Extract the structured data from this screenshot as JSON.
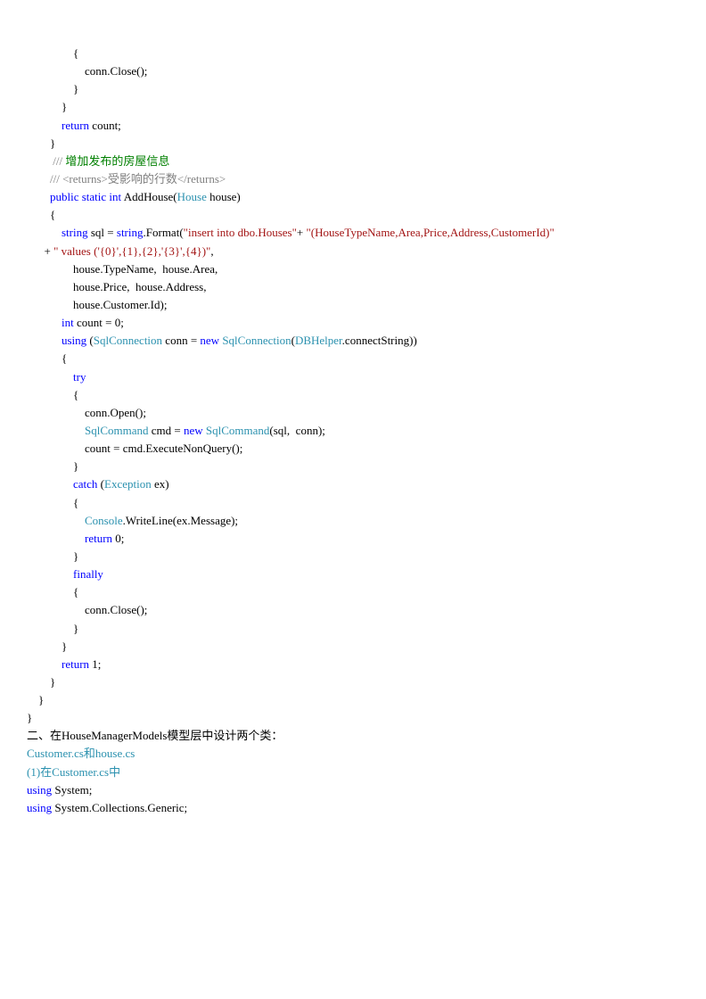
{
  "code": {
    "l1": "                {",
    "l2a": "                    conn.",
    "l2b": "Close();",
    "l3": "                }",
    "l4": "            }",
    "l5a": "            return",
    "l5b": " count;",
    "l6": "        }",
    "l7a": "         /// ",
    "l7b": "增加发布的房屋信息",
    "l8": "        /// <returns>受影响的行数</returns>",
    "l9a": "        public static int ",
    "l9b": "AddHouse(",
    "l9c": "House ",
    "l9d": "house)",
    "l10": "        {",
    "l11a": "            string ",
    "l11b": "sql = ",
    "l11c": "string",
    "l11d": ".Format(",
    "l11e": "\"insert into dbo.Houses\"",
    "l11f": "+ ",
    "l11g": "\"(HouseTypeName,Area,Price,Address,CustomerId)\"",
    "l12a": "      + ",
    "l12b": "\" values ('{0}',{1},{2},'{3}',{4})\"",
    "l12c": ",",
    "l13a": "                house.TypeName,  ",
    "l13b": "house.Area,",
    "l14a": "                house.Price,  ",
    "l14b": "house.Address,",
    "l15": "                house.Customer.Id);",
    "l16a": "            int ",
    "l16b": "count = 0;",
    "l17a": "            using ",
    "l17b": "(",
    "l17c": "SqlConnection ",
    "l17d": "conn = ",
    "l17e": "new ",
    "l17f": "SqlConnection",
    "l17g": "(",
    "l17h": "DBHelper",
    "l17i": ".connectString))",
    "l18": "            {",
    "l19": "                try",
    "l20": "                {",
    "l21": "                    conn.Open();",
    "l22a": "                    ",
    "l22b": "SqlCommand ",
    "l22c": "cmd = ",
    "l22d": "new ",
    "l22e": "SqlCommand",
    "l22f": "(sql,  conn);",
    "l23": "                    count = cmd.ExecuteNonQuery();",
    "l24": "                }",
    "l25a": "                catch ",
    "l25b": "(",
    "l25c": "Exception ",
    "l25d": "ex)",
    "l26": "                {",
    "l27a": "                    ",
    "l27b": "Console",
    "l27c": ".WriteLine(ex.Message);",
    "l28a": "                    return ",
    "l28b": "0;",
    "l29": "                }",
    "l30": "                finally",
    "l31": "                {",
    "l32": "                    conn.Close();",
    "l33": "                }",
    "l34": "            }",
    "l35a": "            return ",
    "l35b": "1;",
    "l36": "        }",
    "l37": "    }",
    "l38": "}",
    "l39": "二、在HouseManagerModels模型层中设计两个类：",
    "l40": "Customer.cs和house.cs",
    "l41": "(1)在Customer.cs中",
    "l42a": "using ",
    "l42b": "System;",
    "l43a": "using ",
    "l43b": "System.Collections.Generic;"
  }
}
